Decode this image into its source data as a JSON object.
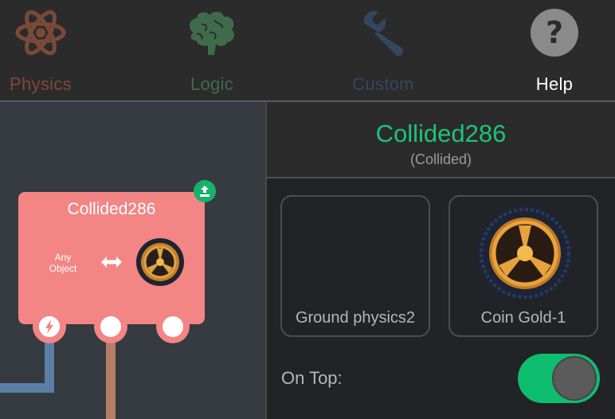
{
  "tabs": [
    {
      "label": "Physics",
      "icon": "atom-icon",
      "color": "#7a4a38"
    },
    {
      "label": "Logic",
      "icon": "brain-icon",
      "color": "#3f6b4a"
    },
    {
      "label": "Custom",
      "icon": "wrench-icon",
      "color": "#35475e"
    },
    {
      "label": "Help",
      "icon": "question-icon",
      "color": "#ffffff"
    }
  ],
  "node": {
    "title": "Collided286",
    "any_object_line1": "Any",
    "any_object_line2": "Object",
    "color": "#f38585"
  },
  "panel": {
    "title": "Collided286",
    "subtitle": "(Collided)",
    "cards": [
      {
        "label": "Ground physics2"
      },
      {
        "label": "Coin Gold-1",
        "icon": "coin-gold-icon"
      }
    ],
    "on_top_label": "On Top:",
    "on_top_enabled": true
  },
  "colors": {
    "accent": "#1fc27a",
    "wire_blue": "#5b7fa6",
    "wire_brown": "#b57e66"
  }
}
